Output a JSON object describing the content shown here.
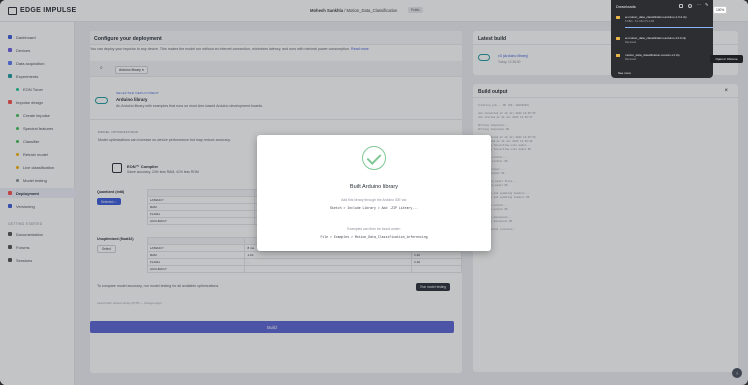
{
  "header": {
    "brand": "EDGE IMPULSE",
    "user": "Mohesh Sankhla",
    "project": "Motion_Data_Classification",
    "badge": "Public"
  },
  "sidebar": {
    "items": [
      {
        "label": "Dashboard",
        "color": "#3b5bdb"
      },
      {
        "label": "Devices",
        "color": "#6c5ce7"
      },
      {
        "label": "Data acquisition",
        "color": "#5c7cfa"
      },
      {
        "label": "Experiments",
        "color": "#1f9aa0"
      },
      {
        "label": "EON Tuner",
        "color": "#20c997",
        "sub": true
      },
      {
        "label": "Impulse design",
        "color": "#fa5252"
      },
      {
        "label": "Create impulse",
        "color": "#40c057",
        "sub": true
      },
      {
        "label": "Spectral features",
        "color": "#40c057",
        "sub": true
      },
      {
        "label": "Classifier",
        "color": "#40c057",
        "sub": true
      },
      {
        "label": "Retrain model",
        "color": "#fab005",
        "sub": true
      },
      {
        "label": "Live classification",
        "color": "#fab005",
        "sub": true
      },
      {
        "label": "Model testing",
        "color": "#868e96",
        "sub": true
      },
      {
        "label": "Deployment",
        "color": "#fa5252",
        "active": true
      },
      {
        "label": "Versioning",
        "color": "#3b5bdb"
      }
    ],
    "section": "GETTING STARTED",
    "bottom": [
      {
        "label": "Documentation",
        "color": "#555"
      },
      {
        "label": "Forums",
        "color": "#555"
      },
      {
        "label": "Sessions",
        "color": "#555"
      }
    ]
  },
  "main": {
    "title": "Configure your deployment",
    "description": "You can deploy your impulse to any device. This makes the model run without an internet connection, minimizes latency, and runs with minimal power consumption.",
    "read_more": "Read more",
    "search_chip": "Arduino library",
    "selected_label": "SELECTED DEPLOYMENT",
    "selected_name": "Arduino library",
    "selected_desc": "An Arduino library with examples that runs on most Arm-based Arduino development boards.",
    "optim_label": "MODEL OPTIMIZATIONS",
    "optim_desc": "Model optimizations can increase on-device performance but may reduce accuracy.",
    "eon_title": "EON™ Compiler",
    "eon_desc": "Same accuracy, 24% less RAM, 41% less ROM",
    "quantized_label": "Quantized (int8)",
    "selected_btn": "Selected ✓",
    "unoptimized_label": "Unoptimized (float32)",
    "select_btn": "Select",
    "table_head": "SPECTRAL FEATURES",
    "rows": [
      "LATENCY",
      "RAM",
      "FLASH",
      "ACCURACY"
    ],
    "q_vals": [
      "8 ms.",
      "1.1K",
      "-",
      ""
    ],
    "u_vals": [
      "8 ms.",
      "1.1K",
      "-",
      ""
    ],
    "u_col2": [
      "",
      "1.1K",
      "2.1K",
      ""
    ],
    "compare_text": "To compare model accuracy, run model testing for all available optimizations.",
    "run_btn": "Run model testing",
    "footer_small": "Latest build: Arduino library (INT8) — Change target",
    "build_btn": "Build"
  },
  "latest": {
    "title": "Latest build",
    "name": "v3 (Arduino library)",
    "date": "Today, 12:36:00"
  },
  "output": {
    "title": "Build output",
    "close": "×",
    "log": "Creating job... OK (ID: 19234853)\n\nJob scheduled at 12 Jul 2023 12:35:55\nJob started at 12 Jul 2023 12:35:57\n\nWriting templates...\nWriting templates OK\n\nJob scheduled at 12 Jul 2023 12:35:58\nJob started at 12 Jul 2023 12:36:00\nExporting TensorFlow Lite model...\nExporting TensorFlow Lite model OK\n\nRemoving clutter...\nRemoving clutter OK\n\nCopying output...\nCopying output OK\n\nExtracting model files...\nExtracting model OK\n\nCompiling and updating headers...\nCompiling and updating headers OK\n\nArchiving output...\nArchiving output OK\n\nUploading documents...\nUploading documents OK\n\nJob completed (success)"
  },
  "modal": {
    "title": "Built Arduino library",
    "add_text": "Add this library through the Arduino IDE via:",
    "add_path": "Sketch > Include Library > Add .ZIP Library...",
    "examples_text": "Examples can then be found under:",
    "examples_path": "File > Examples > Motion_Data_Classification_inferencing"
  },
  "downloads": {
    "title": "Downloads",
    "items": [
      {
        "name": "ei-motion_data_classification-arduino-1.0.2.zip",
        "sub": "5 KB/s - 5.1 KB of 5.1 KB"
      },
      {
        "name": "ei-motion_data_classification-arduino-14.0.zip",
        "sub": "Removed"
      },
      {
        "name": "motion_data_classification-custom-v1.zip",
        "sub": "Removed"
      }
    ],
    "more": "See more",
    "tooltip": "Open in Chrome",
    "zoom": "100%"
  },
  "help": "?"
}
